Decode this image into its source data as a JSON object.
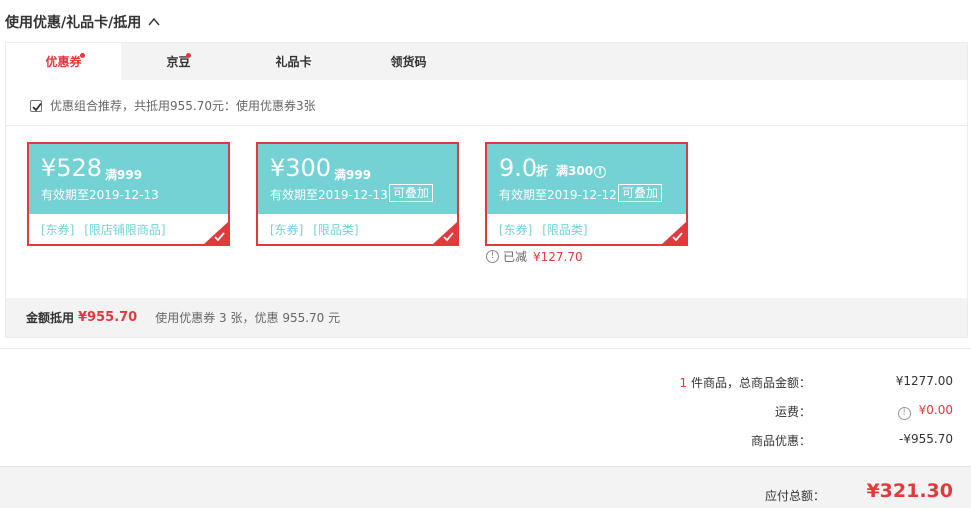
{
  "section": {
    "title": "使用优惠/礼品卡/抵用"
  },
  "tabs": [
    {
      "label": "优惠券",
      "active": true,
      "dot": true
    },
    {
      "label": "京豆",
      "active": false,
      "dot": true
    },
    {
      "label": "礼品卡",
      "active": false,
      "dot": false
    },
    {
      "label": "领货码",
      "active": false,
      "dot": false
    }
  ],
  "combo": {
    "checked": true,
    "text": "优惠组合推荐，共抵用955.70元：使用优惠券3张"
  },
  "coupons": [
    {
      "amount": "¥528",
      "condition": "满999",
      "valid": "有效期至2019-12-13",
      "stackable": "",
      "tags": [
        "[东券]",
        "[限店铺限商品]"
      ],
      "selected": true
    },
    {
      "amount": "¥300",
      "condition": "满999",
      "valid": "有效期至2019-12-13",
      "stackable": "可叠加",
      "tags": [
        "[东券]",
        "[限品类]"
      ],
      "selected": true
    },
    {
      "amount": "9.0",
      "amount_suffix": "折",
      "condition": "满300",
      "valid": "有效期至2019-12-12",
      "stackable": "可叠加",
      "tags": [
        "[东券]",
        "[限品类]"
      ],
      "selected": true
    }
  ],
  "reduced": {
    "label": "已减",
    "amount": "¥127.70"
  },
  "summary": {
    "label": "金额抵用",
    "value": "¥955.70",
    "desc": "使用优惠券 3 张，优惠 955.70 元"
  },
  "totals": {
    "items_count": "1",
    "items_label": " 件商品，总商品金额：",
    "items_value": "¥1277.00",
    "shipping_label": "运费：",
    "shipping_value": "¥0.00",
    "discount_label": "商品优惠：",
    "discount_value": "-¥955.70"
  },
  "pay": {
    "label": "应付总额：",
    "value": "¥321.30"
  },
  "colors": {
    "accent": "#e4393c",
    "coupon": "#74d2d4",
    "bar": "#f3f3f3"
  }
}
